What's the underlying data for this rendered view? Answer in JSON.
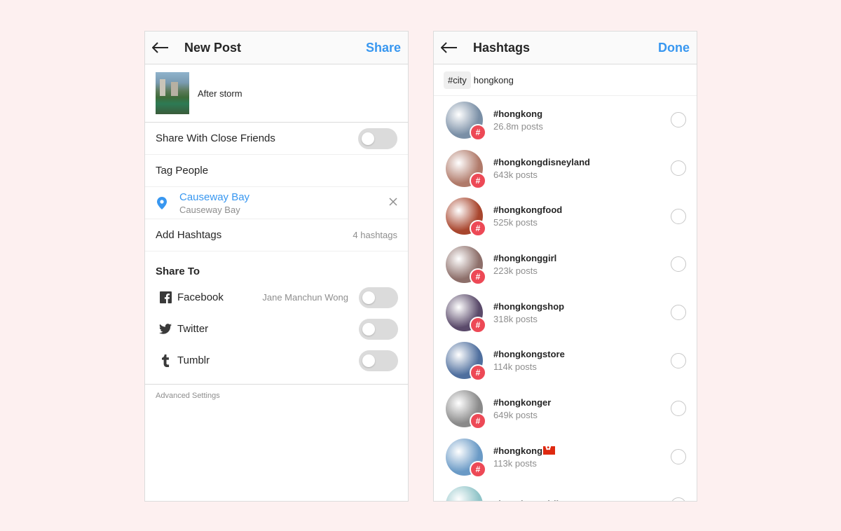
{
  "new_post": {
    "title": "New Post",
    "share_label": "Share",
    "caption": "After storm",
    "close_friends_label": "Share With Close Friends",
    "tag_people_label": "Tag People",
    "location": {
      "name": "Causeway Bay",
      "subtitle": "Causeway Bay"
    },
    "add_hashtags_label": "Add Hashtags",
    "hashtag_count": "4 hashtags",
    "share_to_title": "Share To",
    "share_to": [
      {
        "label": "Facebook",
        "account": "Jane Manchun Wong",
        "icon": "facebook-icon"
      },
      {
        "label": "Twitter",
        "account": "",
        "icon": "twitter-icon"
      },
      {
        "label": "Tumblr",
        "account": "",
        "icon": "tumblr-icon"
      }
    ],
    "advanced_settings_label": "Advanced Settings"
  },
  "hashtags": {
    "title": "Hashtags",
    "done_label": "Done",
    "chip": "#city",
    "query": "hongkong",
    "items": [
      {
        "name": "#hongkong",
        "count": "26.8m posts",
        "color": "#7a8fa6"
      },
      {
        "name": "#hongkongdisneyland",
        "count": "643k posts",
        "color": "#b07a6a"
      },
      {
        "name": "#hongkongfood",
        "count": "525k posts",
        "color": "#a8462e"
      },
      {
        "name": "#hongkonggirl",
        "count": "223k posts",
        "color": "#8d6f6a"
      },
      {
        "name": "#hongkongshop",
        "count": "318k posts",
        "color": "#5a4a6a"
      },
      {
        "name": "#hongkongstore",
        "count": "114k posts",
        "color": "#4f6f9e"
      },
      {
        "name": "#hongkonger",
        "count": "649k posts",
        "color": "#8a8a8a"
      },
      {
        "name": "#hongkong",
        "count": "113k posts",
        "color": "#6a9ac6",
        "flag": true
      },
      {
        "name": "#hongkongairlines",
        "count": "",
        "color": "#8fc4c8"
      }
    ]
  },
  "colors": {
    "accent": "#3897f0",
    "badge": "#ed4956",
    "background": "#fdf0f0"
  }
}
